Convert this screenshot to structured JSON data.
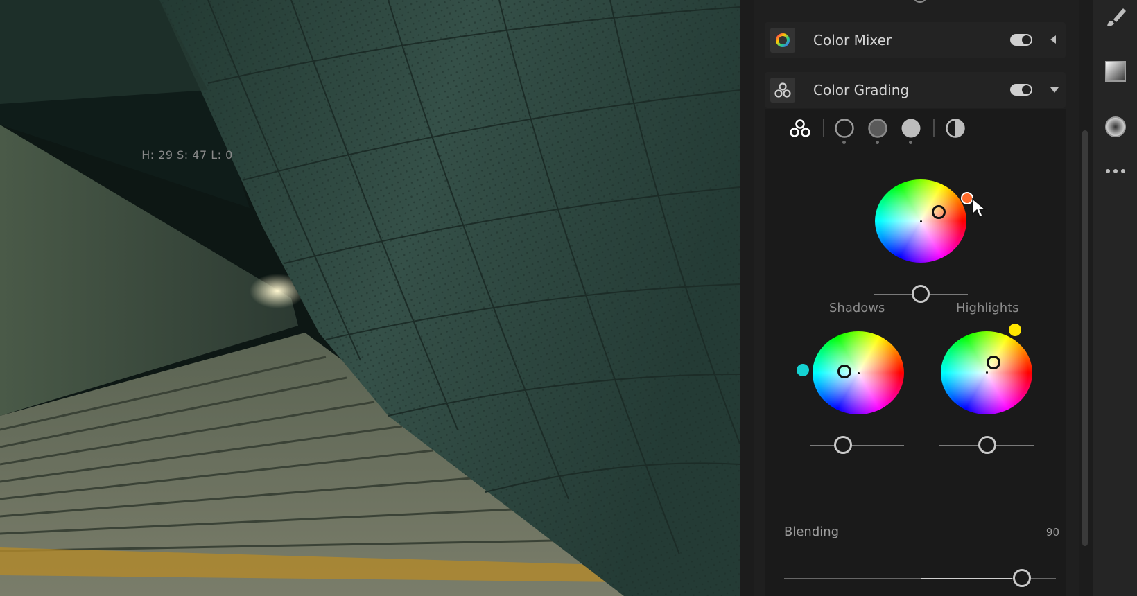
{
  "app": "Lightroom Edit Panel",
  "sections": {
    "color_mixer": {
      "title": "Color Mixer",
      "enabled": true,
      "icon": "color-mixer-icon"
    },
    "color_grading": {
      "title": "Color Grading",
      "enabled": true,
      "icon": "color-grading-icon",
      "modes": [
        "three-way",
        "shadows",
        "midtones",
        "highlights",
        "global"
      ],
      "readout": "H: 29 S: 47 L: 0",
      "midtones": {
        "hue": 29,
        "saturation": 47,
        "luminance": 0
      },
      "shadows_label": "Shadows",
      "highlights_label": "Highlights",
      "blending_label": "Blending",
      "blending_value": "90",
      "colors": {
        "midtone_hue": "#ff6a2a",
        "shadow_hue": "#15d3d3",
        "highlight_hue": "#ffe600"
      }
    }
  },
  "toolbar": {
    "items": [
      "brush-icon",
      "gradient-icon",
      "radial-icon",
      "more-icon"
    ]
  }
}
